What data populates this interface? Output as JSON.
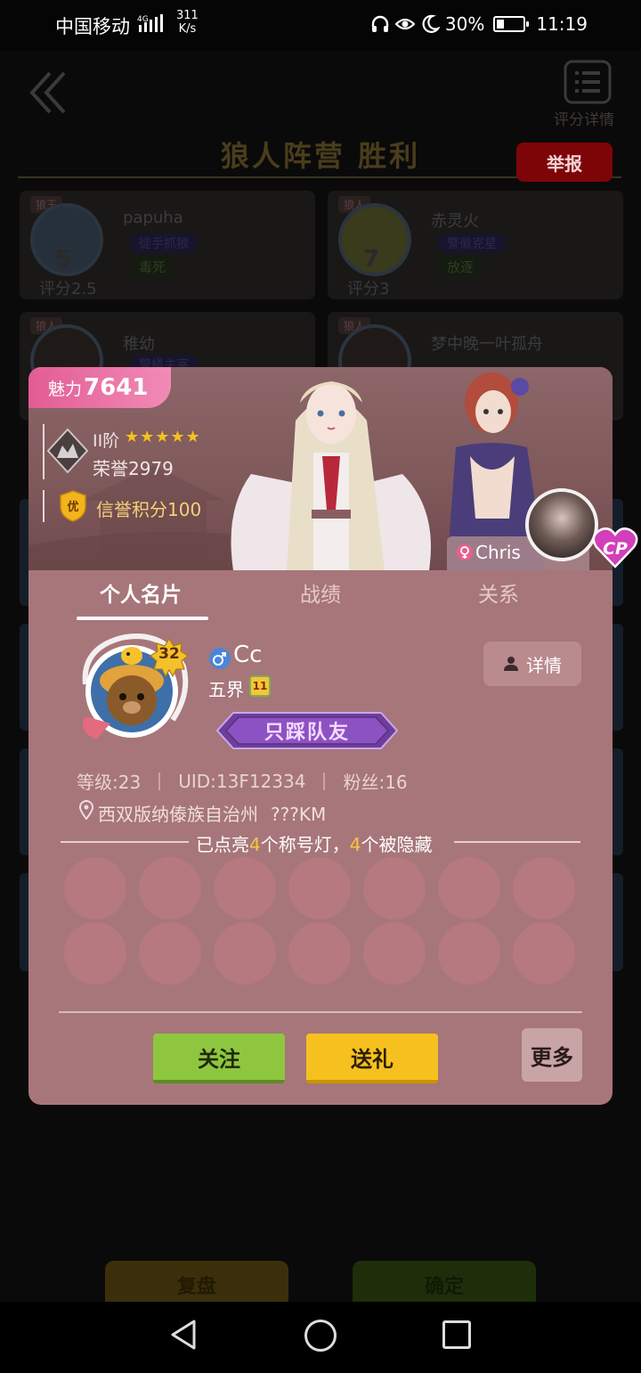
{
  "status_bar": {
    "carrier": "中国移动",
    "network": "4G",
    "speed_value": "311",
    "speed_unit": "K/s",
    "battery": "30%",
    "battery_level": 0.3,
    "time": "11:19"
  },
  "header": {
    "detail_label": "评分详情",
    "result_title": "狼人阵营  胜利",
    "report_label": "举报"
  },
  "players": [
    {
      "role": "狼王",
      "seat": "5",
      "score": "评分2.5",
      "name": "papuha",
      "tag": "徒手抓狼",
      "fate": "毒死"
    },
    {
      "role": "狼人",
      "seat": "7",
      "score": "评分3",
      "name": "赤灵火",
      "tag": "警徽克星",
      "fate": "放逐"
    },
    {
      "role": "狼人",
      "seat": "",
      "score": "",
      "name": "稚幼",
      "tag": "警橘主宰",
      "fate": ""
    },
    {
      "role": "狼人",
      "seat": "",
      "score": "",
      "name": "梦中晚一叶孤舟",
      "tag": "",
      "fate": ""
    }
  ],
  "bottom_buttons": {
    "replay": "复盘",
    "confirm": "确定"
  },
  "profile": {
    "charm_label": "魅力",
    "charm_value": "7641",
    "rank_tier": "II阶",
    "stars": "★★★★★",
    "honor": "荣誉2979",
    "credit_badge": "优",
    "credit": "信誉积分100",
    "cp_partner": "Chris",
    "cp_badge": "CP",
    "tabs": [
      "个人名片",
      "战绩",
      "关系"
    ],
    "level": "32",
    "nickname": "Cc",
    "realm": "五界",
    "realm_badge": "11",
    "title_badge": "只踩队友",
    "details_button": "详情",
    "stat_level": "等级:23",
    "stat_uid": "UID:13F12334",
    "stat_fans": "粉丝:16",
    "location": "西双版纳傣族自治州",
    "distance": "???KM",
    "lamps_prefix": "已点亮",
    "lamps_lit": "4",
    "lamps_mid": "个称号灯，",
    "lamps_hidden": "4",
    "lamps_suffix": "个被隐藏",
    "follow_button": "关注",
    "gift_button": "送礼",
    "more_button": "更多"
  },
  "colors": {
    "modal_bg": "#a7767a",
    "charm_pink": "#e35c94",
    "follow_green": "#8fc640",
    "gift_yellow": "#f6c11f",
    "highlight_yellow": "#f4c63a",
    "report_red": "#7d0508"
  },
  "icons": [
    "signal-icon",
    "headphones-icon",
    "eye-icon",
    "moon-icon",
    "battery-icon",
    "back-chevrons-icon",
    "list-detail-icon",
    "rank-wolf-badge-icon",
    "credit-shield-icon",
    "female-icon",
    "male-icon",
    "person-icon",
    "location-pin-icon",
    "cp-badge-icon",
    "nav-back-icon",
    "nav-home-icon",
    "nav-recent-icon"
  ]
}
